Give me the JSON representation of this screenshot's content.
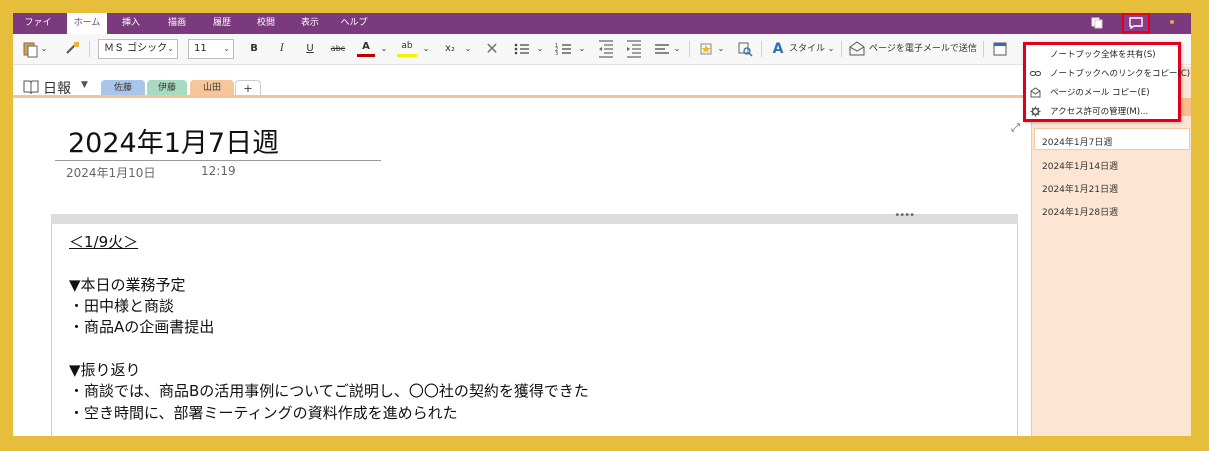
{
  "ribbon": {
    "tabs": [
      "ファイル",
      "ホーム",
      "挿入",
      "描画",
      "履歴",
      "校閲",
      "表示",
      "ヘルプ"
    ],
    "active_tab": "ホーム"
  },
  "toolbar": {
    "font_name": "ＭＳ ゴシック",
    "font_size": "11",
    "bold": "B",
    "italic": "I",
    "underline": "U",
    "strikethrough": "abc",
    "font_color": "A",
    "highlight": "ab",
    "subscript": "x₂",
    "styles_label": "スタイル",
    "email_page_label": "ページを電子メールで送信"
  },
  "notebook": {
    "title": "日報",
    "sections": [
      "佐藤",
      "伊藤",
      "山田",
      "+"
    ],
    "active_section": "山田"
  },
  "page": {
    "title": "2024年1月7日週",
    "date": "2024年1月10日",
    "time": "12:19",
    "lines": [
      "＜1/9火＞",
      "",
      "▼本日の業務予定",
      "・田中様と商談",
      "・商品Aの企画書提出",
      "",
      "▼振り返り",
      "・商談では、商品Bの活用事例についてご説明し、〇〇社の契約を獲得できた",
      "・空き時間に、部署ミーティングの資料作成を進められた"
    ]
  },
  "pages_pane": {
    "items": [
      "2024年1月7日週",
      "2024年1月14日週",
      "2024年1月21日週",
      "2024年1月28日週"
    ],
    "selected": "2024年1月7日週"
  },
  "share_menu": {
    "items": [
      {
        "label": "ノートブック全体を共有(S)",
        "icon": "share-icon"
      },
      {
        "label": "ノートブックへのリンクをコピー(C)",
        "icon": "link-icon"
      },
      {
        "label": "ページのメール コピー(E)",
        "icon": "mail-icon"
      },
      {
        "label": "アクセス許可の管理(M)...",
        "icon": "gear-icon"
      }
    ]
  },
  "colors": {
    "ribbon": "#7B3A7D",
    "highlight_border": "#E0001B",
    "frame": "#E6BE3C",
    "pane": "#FCE5D2",
    "section_sato": "#A9C6E8",
    "section_ito": "#A8D9C1",
    "section_yamada": "#F6C69A"
  }
}
